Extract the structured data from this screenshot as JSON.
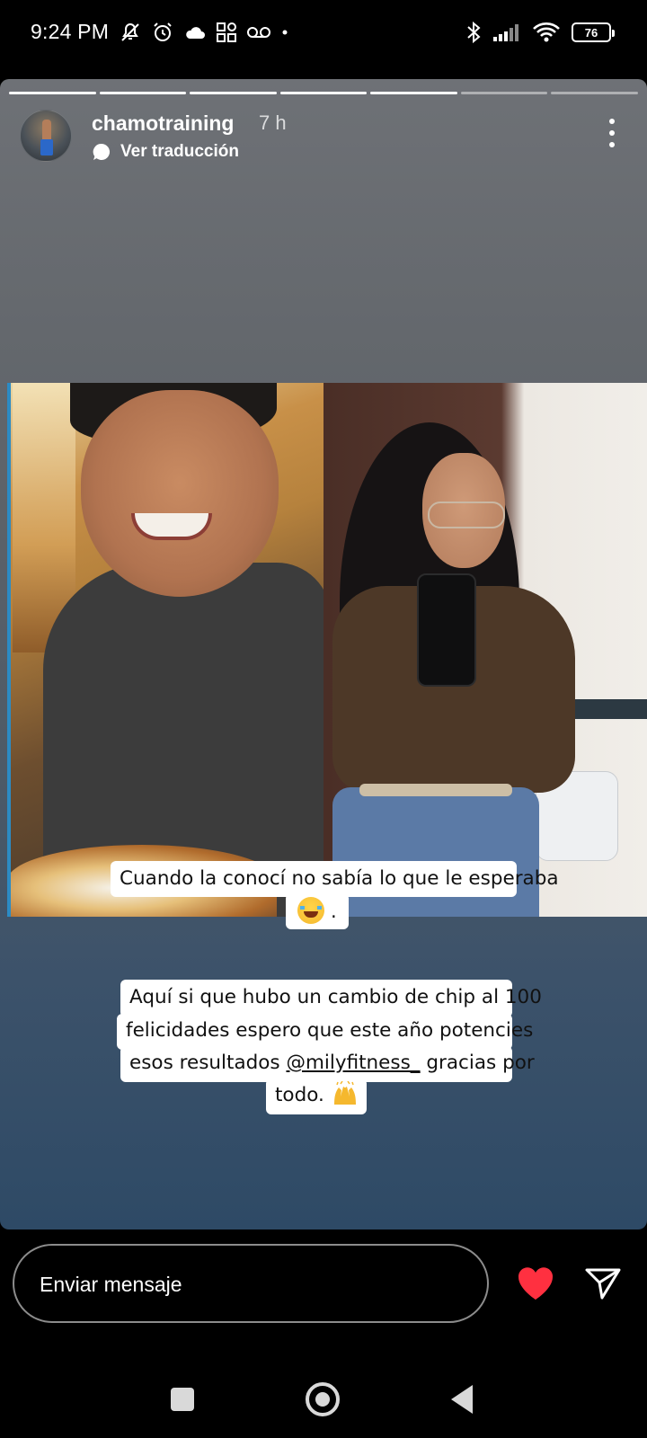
{
  "status_bar": {
    "time": "9:24 PM",
    "left_icons": [
      "mute-icon",
      "alarm-icon",
      "cloud-icon",
      "apps-grid-icon",
      "voicemail-icon",
      "dot-icon"
    ],
    "right_icons": [
      "bluetooth-icon",
      "signal-icon",
      "wifi-icon"
    ],
    "battery": "76"
  },
  "story": {
    "progress": {
      "segments": 7,
      "completed": 5,
      "current_index": 5
    },
    "username": "chamotraining",
    "time_ago": "7 h",
    "translate_label": "Ver traducción",
    "photo_description_icon": "before-after-photo",
    "captions": {
      "line1": "Cuando la conocí no sabía lo que le esperaba",
      "line1_suffix": ".",
      "line2": "Aquí si que hubo un cambio de chip al 100",
      "line3": "felicidades espero que este año potencies",
      "line4_prefix": "esos resultados ",
      "line4_mention": "@milyfitness_",
      "line4_suffix": " gracias por",
      "line5": "todo. "
    }
  },
  "reply_bar": {
    "placeholder": "Enviar mensaje",
    "like_color": "#ff3040"
  },
  "nav_bar": {
    "buttons": [
      "recents",
      "home",
      "back"
    ]
  }
}
